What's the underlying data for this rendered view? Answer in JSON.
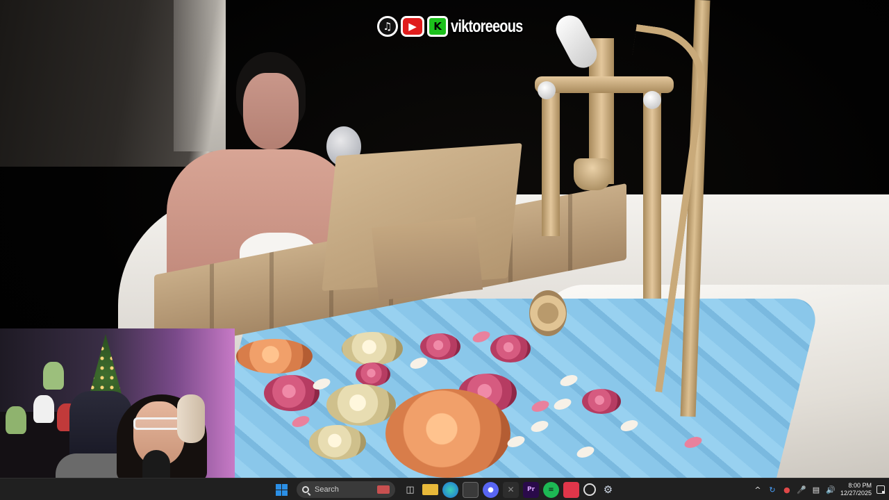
{
  "overlay": {
    "social_icons": [
      "tiktok-icon",
      "youtube-icon",
      "kick-icon"
    ],
    "kick_glyph": "K",
    "handle": "viktoreeous"
  },
  "taskbar": {
    "search_placeholder": "Search",
    "pinned_apps": [
      "task-view",
      "file-explorer",
      "edge",
      "microsoft-store",
      "discord",
      "excel",
      "premiere-pro",
      "spotify",
      "stream-app",
      "streamlabs",
      "settings"
    ],
    "tray": {
      "chevron": "^",
      "icons": [
        "sync-icon",
        "record-icon",
        "mic-icon",
        "network-icon",
        "speaker-icon"
      ]
    },
    "clock": {
      "time": "8:00 PM",
      "date": "12/27/2025"
    }
  },
  "colors": {
    "taskbar_bg": "#202020",
    "windows_blue": "#2b8fe6",
    "water": "#8ac7ea",
    "brass": "#c9aa7a"
  }
}
